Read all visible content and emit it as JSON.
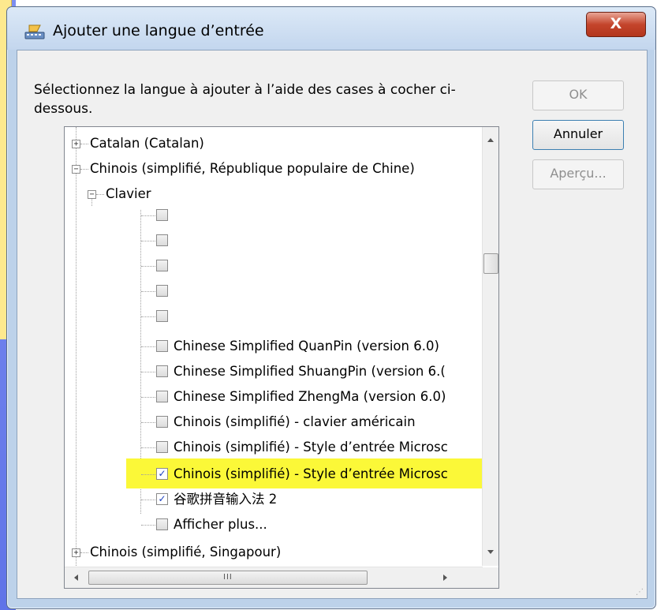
{
  "dialog": {
    "title": "Ajouter une langue d’entrée",
    "close_symbol": "X",
    "prompt": "Sélectionnez la langue à ajouter à l’aide des cases à cocher ci-dessous.",
    "buttons": {
      "ok": "OK",
      "cancel": "Annuler",
      "preview": "Aperçu..."
    }
  },
  "tree": {
    "catalan": "Catalan (Catalan)",
    "chinese_prc": "Chinois (simplifié, République populaire de Chine)",
    "keyboard": "Clavier",
    "items": {
      "quanpin": "Chinese Simplified QuanPin (version 6.0)",
      "shuangpin": "Chinese Simplified ShuangPin (version 6.(",
      "zhengma": "Chinese Simplified ZhengMa (version 6.0)",
      "us_keyboard": "Chinois (simplifié) - clavier américain",
      "ms_style_1": "Chinois (simplifié) - Style d’entrée Microsc",
      "ms_style_2": "Chinois (simplifié) - Style d’entrée Microsc",
      "google_pinyin": "谷歌拼音输入法 2",
      "more": "Afficher plus..."
    },
    "chinese_sg": "Chinois (simplifié, Singapour)",
    "scroll_grip": "III"
  },
  "colors": {
    "highlight": "#fbf838",
    "close_button": "#c4452c"
  }
}
